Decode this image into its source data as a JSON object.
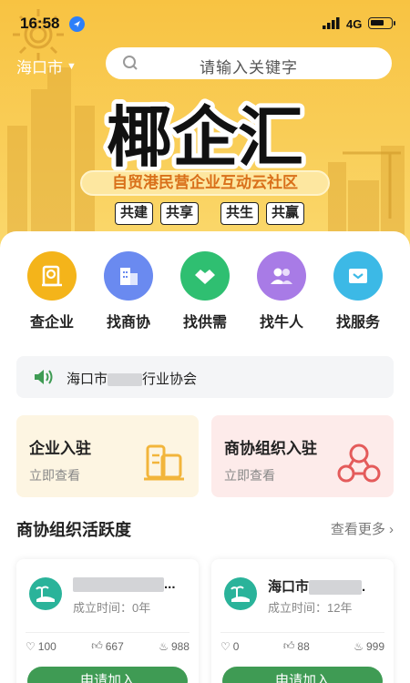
{
  "status": {
    "time": "16:58",
    "network": "4G"
  },
  "header": {
    "city": "海口市",
    "search_placeholder": "请输入关键字"
  },
  "banner": {
    "logo_text": "椰企汇",
    "slogan": "自贸港民营企业互动云社区",
    "tags": [
      "共建",
      "共享",
      "共生",
      "共赢"
    ]
  },
  "quick_links": [
    {
      "label": "查企业",
      "icon": "company-search-icon",
      "color": "#f4b41a"
    },
    {
      "label": "找商协",
      "icon": "building-icon",
      "color": "#6a8af0"
    },
    {
      "label": "找供需",
      "icon": "handshake-icon",
      "color": "#2fbf71"
    },
    {
      "label": "找牛人",
      "icon": "people-icon",
      "color": "#a87be6"
    },
    {
      "label": "找服务",
      "icon": "service-icon",
      "color": "#3cb9e6"
    }
  ],
  "notice": {
    "prefix": "海口市",
    "suffix": "行业协会"
  },
  "promos": [
    {
      "title": "企业入驻",
      "subtitle": "立即查看"
    },
    {
      "title": "商协组织入驻",
      "subtitle": "立即查看"
    }
  ],
  "section": {
    "title": "商协组织活跃度",
    "more": "查看更多"
  },
  "orgs": [
    {
      "name_suffix": "...",
      "established": "成立时间：0年",
      "followers": "100",
      "likes": "667",
      "heat": "988",
      "join": "申请加入"
    },
    {
      "name_prefix": "海口市",
      "name_suffix": ".",
      "established": "成立时间：12年",
      "followers": "0",
      "likes": "88",
      "heat": "999",
      "join": "申请加入"
    }
  ],
  "colors": {
    "brand_yellow": "#f8c342",
    "join_green": "#3f9b54",
    "text": "#222222"
  }
}
